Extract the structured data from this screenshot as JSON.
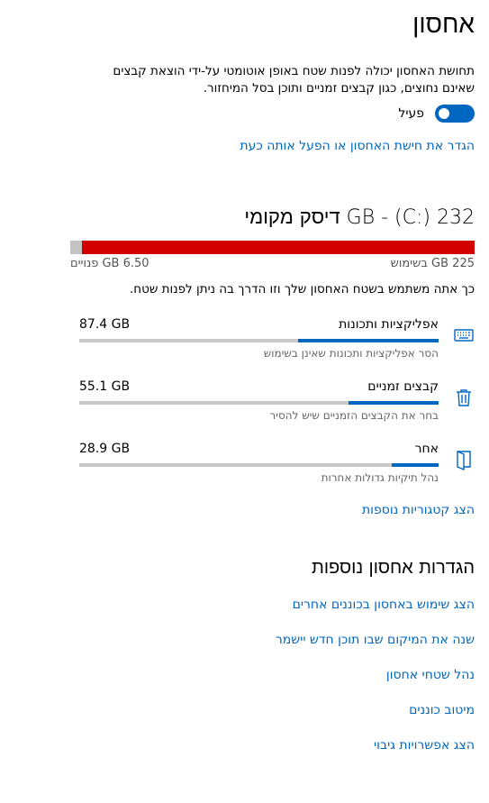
{
  "page": {
    "title": "אחסון",
    "description": "תחושת האחסון יכולה לפנות שטח באופן אוטומטי על-ידי הוצאת קבצים שאינם נחוצים, כגון קבצים זמניים ותוכן בסל המיחזור.",
    "toggle": {
      "state_label": "פעיל",
      "on": true
    },
    "configure_link": "הגדר את חישת האחסון או הפעל אותה כעת"
  },
  "disk": {
    "title": "232 GB - (C:) דיסק מקומי",
    "used_label": "225 GB בשימוש",
    "free_label": "6.50 GB פנויים",
    "used_fraction": 0.972,
    "info": "כך אתה משתמש בשטח האחסון שלך וזו הדרך בה ניתן לפנות שטח."
  },
  "categories": [
    {
      "name": "אפליקציות ותכונות",
      "size": "87.4 GB",
      "sub": "הסר אפליקציות ותכונות שאינן בשימוש",
      "fraction": 0.39,
      "icon": "keyboard-icon"
    },
    {
      "name": "קבצים זמניים",
      "size": "55.1 GB",
      "sub": "בחר את הקבצים הזמניים שיש להסיר",
      "fraction": 0.25,
      "icon": "trash-icon"
    },
    {
      "name": "אחר",
      "size": "28.9 GB",
      "sub": "נהל תיקיות גדולות אחרות",
      "fraction": 0.13,
      "icon": "folder-icon"
    }
  ],
  "show_more_link": "הצג קטגוריות נוספות",
  "more_settings": {
    "title": "הגדרות אחסון נוספות",
    "links": [
      "הצג שימוש באחסון בכוננים אחרים",
      "שנה את המיקום שבו תוכן חדש יישמר",
      "נהל שטחי אחסון",
      "מיטוב כוננים",
      "הצג אפשרויות גיבוי"
    ]
  },
  "colors": {
    "accent": "#0067c0",
    "used_bar": "#d20000",
    "track": "#c8c8c8"
  }
}
